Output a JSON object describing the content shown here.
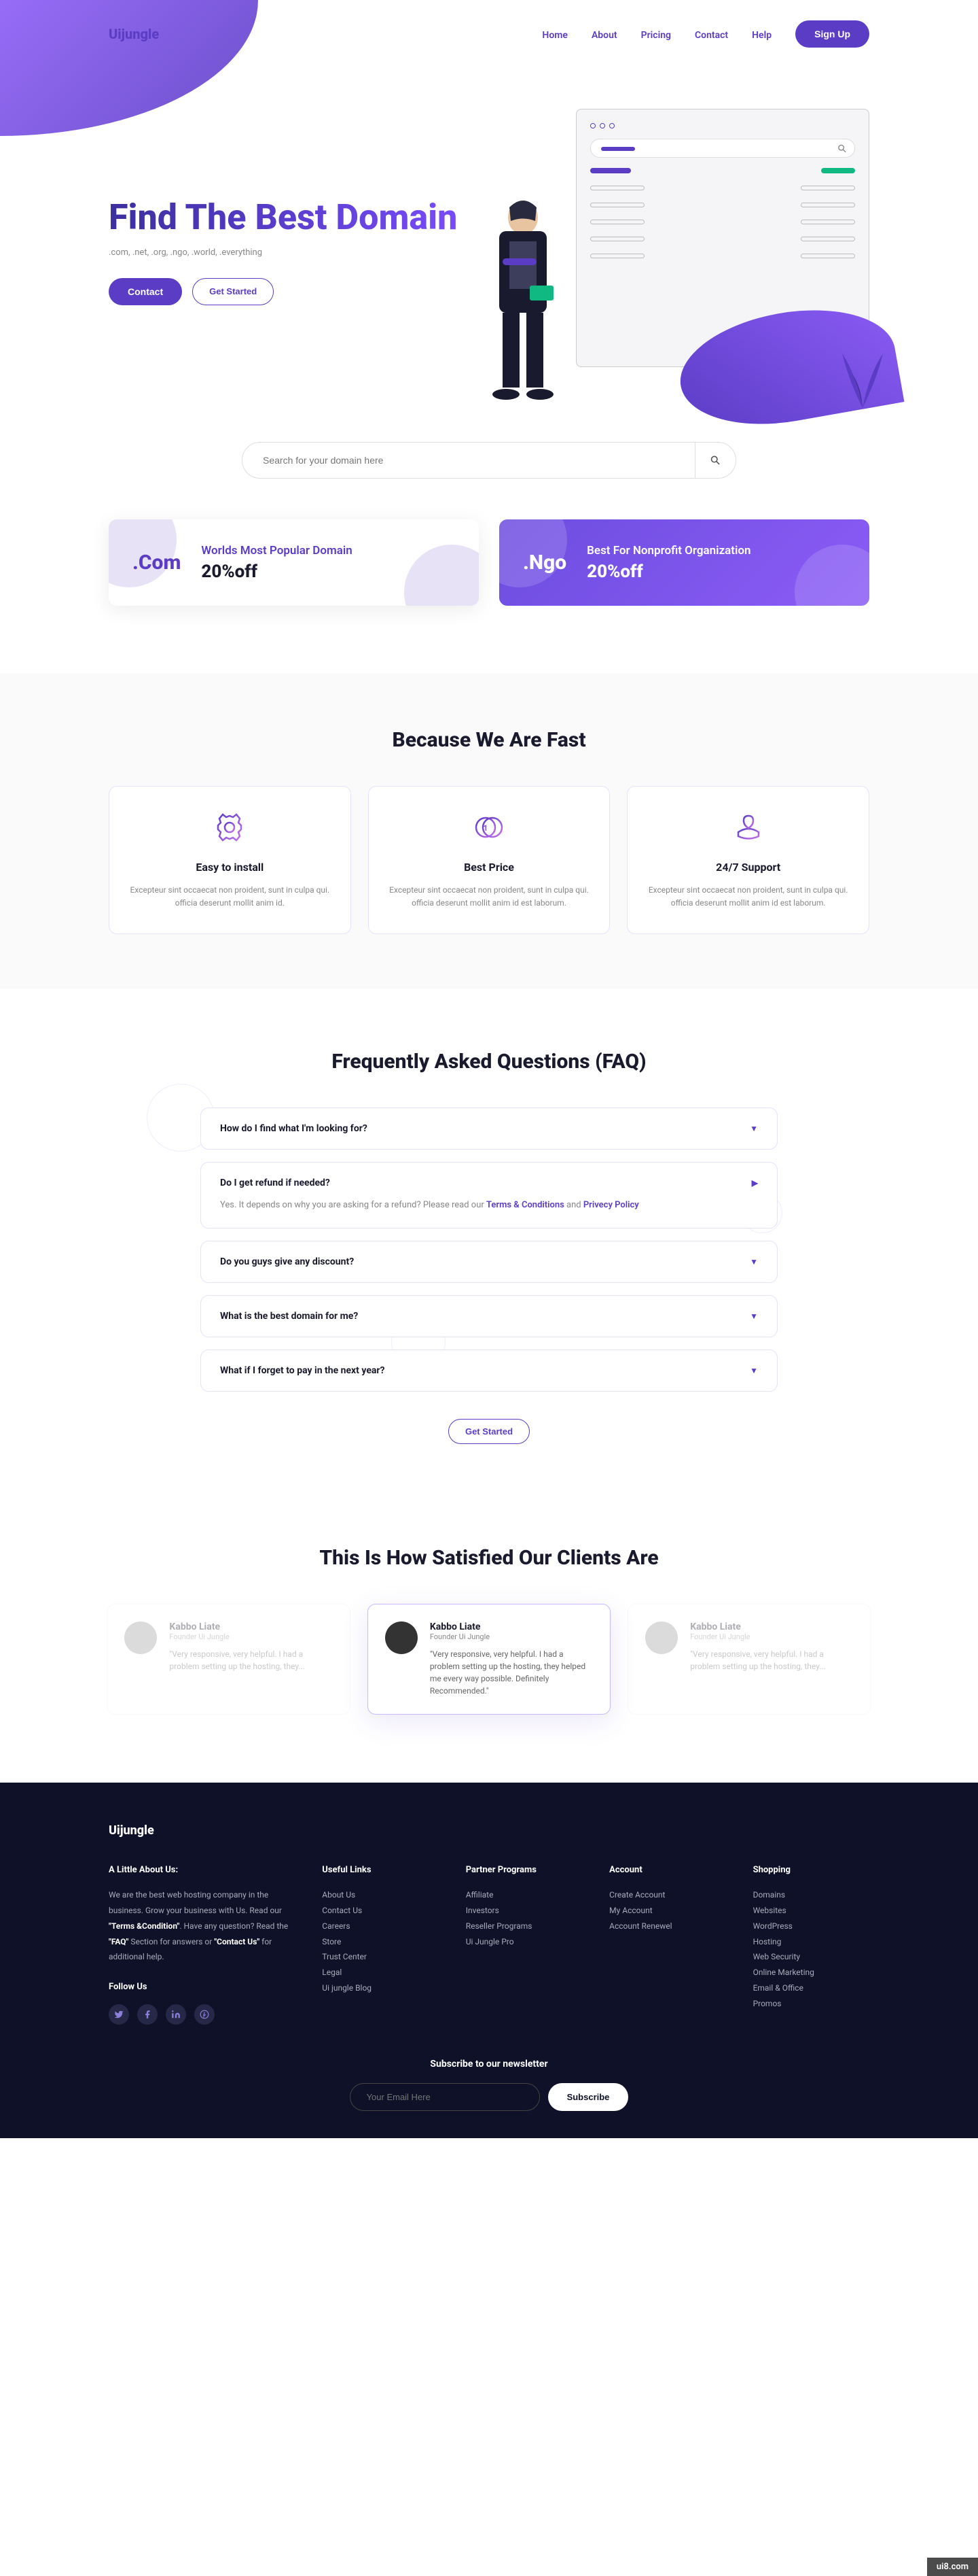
{
  "brand": "Uijungle",
  "nav": {
    "home": "Home",
    "about": "About",
    "pricing": "Pricing",
    "contact": "Contact",
    "help": "Help",
    "signup": "Sign Up"
  },
  "hero": {
    "title": "Find The Best Domain",
    "subtitle": ".com, .net, .org, .ngo, .world, .everything",
    "contact_btn": "Contact",
    "getstarted_btn": "Get Started"
  },
  "search": {
    "placeholder": "Search for your domain here"
  },
  "promos": [
    {
      "ext": ".Com",
      "line1": "Worlds Most Popular Domain",
      "line2": "20%off"
    },
    {
      "ext": ".Ngo",
      "line1": "Best For Nonprofit Organization",
      "line2": "20%off"
    }
  ],
  "features": {
    "title": "Because We Are Fast",
    "items": [
      {
        "title": "Easy to install",
        "desc": "Excepteur sint occaecat non proident, sunt in culpa qui. officia deserunt mollit anim id."
      },
      {
        "title": "Best Price",
        "desc": "Excepteur sint occaecat non proident, sunt in culpa qui. officia deserunt mollit anim id est laborum."
      },
      {
        "title": "24/7 Support",
        "desc": "Excepteur sint occaecat non proident, sunt in culpa qui. officia deserunt mollit anim id est laborum."
      }
    ]
  },
  "faq": {
    "title": "Frequently Asked Questions (FAQ)",
    "items": [
      {
        "q": "How do I find what I'm looking for?",
        "open": false
      },
      {
        "q": "Do I get refund if needed?",
        "open": true,
        "a_prefix": "Yes. It depends on why you are asking for a refund? Please read our ",
        "link1": "Terms & Conditions",
        "mid": " and ",
        "link2": "Privecy Policy"
      },
      {
        "q": "Do you guys give any discount?",
        "open": false
      },
      {
        "q": "What is the best domain for me?",
        "open": false
      },
      {
        "q": "What if I forget to pay in the next year?",
        "open": false
      }
    ],
    "cta": "Get Started"
  },
  "testimonials": {
    "title": "This Is How Satisfied Our Clients Are",
    "items": [
      {
        "name": "Kabbo Liate",
        "role": "Founder Ui Jungle",
        "quote": "\"Very responsive, very helpful. I had a problem setting up the hosting, they..."
      },
      {
        "name": "Kabbo Liate",
        "role": "Founder Ui Jungle",
        "quote": "\"Very responsive, very helpful. I had a problem setting up the hosting, they helped me every way possible. Definitely Recommended.\""
      },
      {
        "name": "Kabbo Liate",
        "role": "Founder Ui Jungle",
        "quote": "\"Very responsive, very helpful. I had a problem setting up the hosting, they..."
      }
    ]
  },
  "footer": {
    "about_title": "A Little About Us:",
    "about_text_1": "We are the best web hosting company in the business. Grow your business with Us. Read our ",
    "about_bold_1": "\"Terms &Condition\"",
    "about_text_2": ". Have any question? Read the ",
    "about_bold_2": "\"FAQ\"",
    "about_text_3": " Section for answers or ",
    "about_bold_3": "\"Contact Us\"",
    "about_text_4": "  for additional help.",
    "follow_title": "Follow Us",
    "cols": {
      "useful": {
        "title": "Useful Links",
        "items": [
          "About Us",
          "Contact Us",
          "Careers",
          "Store",
          "Trust Center",
          "Legal",
          "Ui jungle Blog"
        ]
      },
      "partner": {
        "title": "Partner Programs",
        "items": [
          "Affiliate",
          "Investors",
          "Reseller Programs",
          "Ui Jungle Pro"
        ]
      },
      "account": {
        "title": "Account",
        "items": [
          "Create Account",
          "My Account",
          "Account Renewel"
        ]
      },
      "shopping": {
        "title": "Shopping",
        "items": [
          "Domains",
          "Websites",
          "WordPress",
          "Hosting",
          "Web Security",
          "Online Marketing",
          "Email & Office",
          "Promos"
        ]
      }
    },
    "newsletter_title": "Subscribe to our newsletter",
    "newsletter_placeholder": "Your Email Here",
    "newsletter_btn": "Subscribe"
  },
  "watermark": "ui8.com"
}
